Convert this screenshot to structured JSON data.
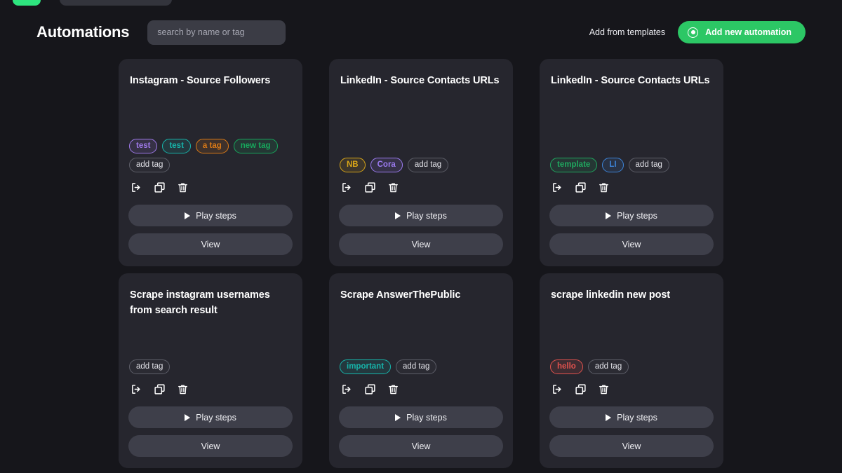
{
  "header": {
    "title": "Automations",
    "search": {
      "value": "",
      "placeholder": "search by name or tag"
    },
    "templates_link": "Add from templates",
    "add_button": {
      "label": "Add new automation",
      "icon": "record-icon",
      "color": "#2cc765"
    }
  },
  "icons": {
    "export": "export-icon",
    "duplicate": "duplicate-icon",
    "delete": "trash-icon"
  },
  "buttons": {
    "play": "Play steps",
    "view": "View"
  },
  "tags_defaults": {
    "add_tag": "add tag"
  },
  "cards": [
    {
      "title": "Instagram - Source Followers",
      "tags": [
        {
          "label": "test",
          "color": "#9f7aea"
        },
        {
          "label": "test",
          "color": "#17b5ab"
        },
        {
          "label": "a tag",
          "color": "#dd7b16"
        },
        {
          "label": "new tag",
          "color": "#17a85c"
        }
      ],
      "add_tag": "add tag",
      "play_label": "Play steps",
      "view_label": "View"
    },
    {
      "title": "LinkedIn - Source Contacts URLs",
      "tags": [
        {
          "label": "NB",
          "color": "#d9a618"
        },
        {
          "label": "Cora",
          "color": "#9b7bf0"
        }
      ],
      "add_tag": "add tag",
      "play_label": "Play steps",
      "view_label": "View"
    },
    {
      "title": "LinkedIn - Source Contacts URLs",
      "tags": [
        {
          "label": "template",
          "color": "#20a85f"
        },
        {
          "label": "LI",
          "color": "#3d84d8"
        }
      ],
      "add_tag": "add tag",
      "play_label": "Play steps",
      "view_label": "View"
    },
    {
      "title": "Scrape instagram usernames from search result",
      "tags": [],
      "add_tag": "add tag",
      "play_label": "Play steps",
      "view_label": "View"
    },
    {
      "title": "Scrape AnswerThePublic",
      "tags": [
        {
          "label": "important",
          "color": "#17b5ab"
        }
      ],
      "add_tag": "add tag",
      "play_label": "Play steps",
      "view_label": "View"
    },
    {
      "title": "scrape linkedin new post",
      "tags": [
        {
          "label": "hello",
          "color": "#e0524e"
        }
      ],
      "add_tag": "add tag",
      "play_label": "Play steps",
      "view_label": "View"
    }
  ],
  "theme": {
    "page_bg": "#16161b",
    "card_bg": "#26262e",
    "button_bg": "#3e3f4a",
    "accent": "#2cc765"
  }
}
